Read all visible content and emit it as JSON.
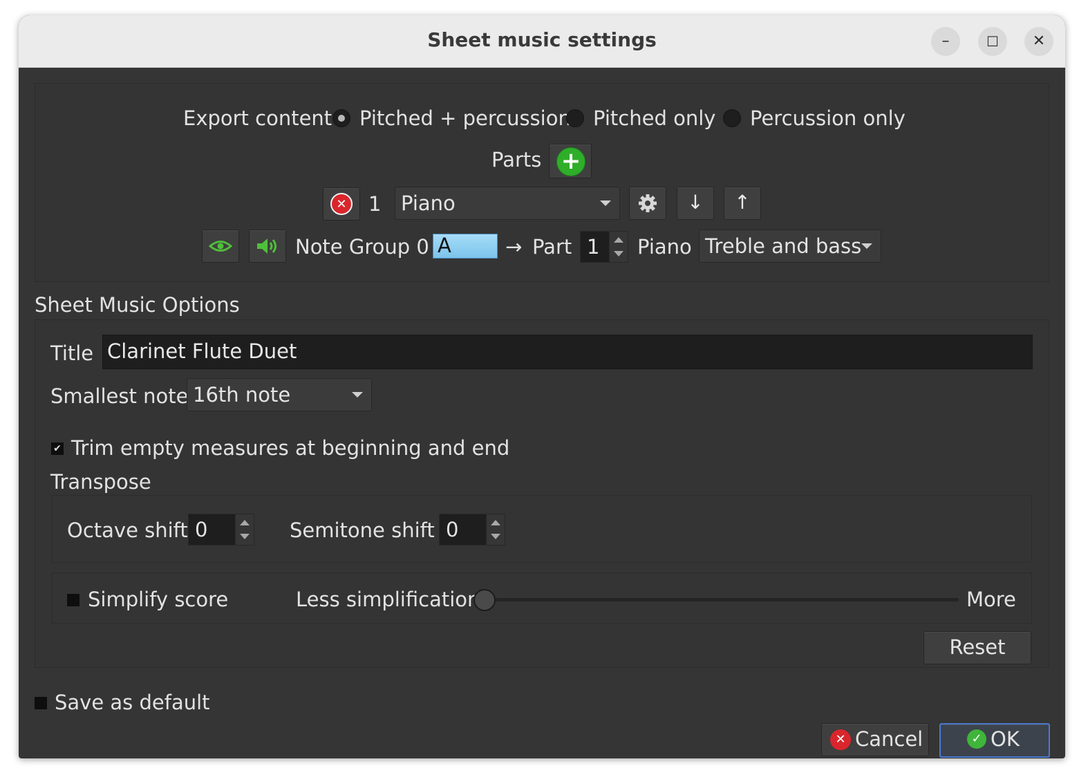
{
  "window": {
    "title": "Sheet music settings"
  },
  "window_controls": {
    "minimize": "–",
    "maximize": "☐",
    "close": "✕"
  },
  "export": {
    "label": "Export content",
    "options": [
      "Pitched + percussion",
      "Pitched only",
      "Percussion only"
    ],
    "selected_index": 0
  },
  "parts": {
    "label": "Parts",
    "add_symbol": "+",
    "row": {
      "remove_symbol": "✕",
      "number": "1",
      "instrument": "Piano",
      "down_symbol": "↓",
      "up_symbol": "↑"
    },
    "mapping": {
      "group_label": "Note Group 0",
      "color_letter": "A",
      "arrow": "→",
      "part_label": "Part",
      "part_value": "1",
      "instrument": "Piano",
      "clef": "Treble and bass"
    }
  },
  "options": {
    "heading": "Sheet Music Options",
    "title_label": "Title",
    "title_value": "Clarinet Flute Duet",
    "smallest_note_label": "Smallest note",
    "smallest_note_value": "16th note",
    "trim_label": "Trim empty measures at beginning and end",
    "trim_checked": true,
    "transpose_label": "Transpose",
    "octave_label": "Octave shift",
    "octave_value": "0",
    "semitone_label": "Semitone shift",
    "semitone_value": "0",
    "simplify_label": "Simplify score",
    "simplify_checked": false,
    "less_label": "Less simplification",
    "more_label": "More",
    "simplification_level": 0,
    "reset_label": "Reset"
  },
  "footer": {
    "save_default_label": "Save as default",
    "save_default_checked": false,
    "cancel_label": "Cancel",
    "ok_label": "OK"
  },
  "colors": {
    "background": "#353535",
    "accent_blue": "#4a7ad0",
    "note_group_color": "#8ed0f2",
    "ok_green": "#3fb53a",
    "cancel_red": "#d9262c"
  }
}
